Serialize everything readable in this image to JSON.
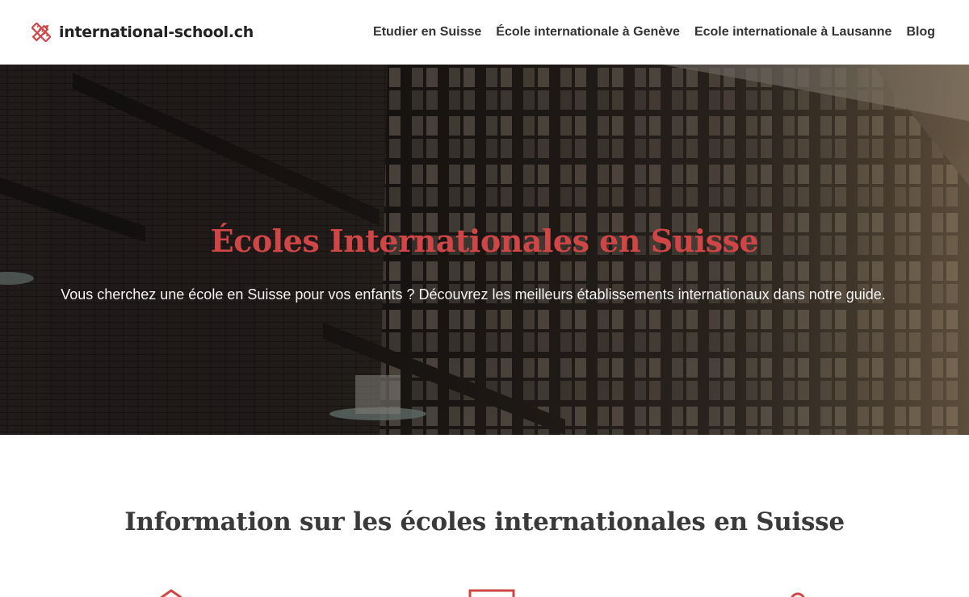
{
  "header": {
    "logo_text": "international-school.ch",
    "logo_icon": "pencil-ruler-icon",
    "nav": [
      {
        "label": "Etudier en Suisse"
      },
      {
        "label": "École internationale à Genève"
      },
      {
        "label": "Ecole internationale à Lausanne"
      },
      {
        "label": "Blog"
      }
    ]
  },
  "hero": {
    "title": "Écoles Internationales en Suisse",
    "subtitle": "Vous cherchez une école en Suisse pour vos enfants ? Découvrez les meilleurs établissements internationaux dans notre guide."
  },
  "info": {
    "title": "Information sur les écoles internationales en Suisse",
    "feature_icons": [
      "house-icon",
      "document-icon",
      "location-pin-icon"
    ]
  },
  "colors": {
    "accent": "#d04646",
    "text_dark": "#333333",
    "header_bg": "#ffffff"
  }
}
